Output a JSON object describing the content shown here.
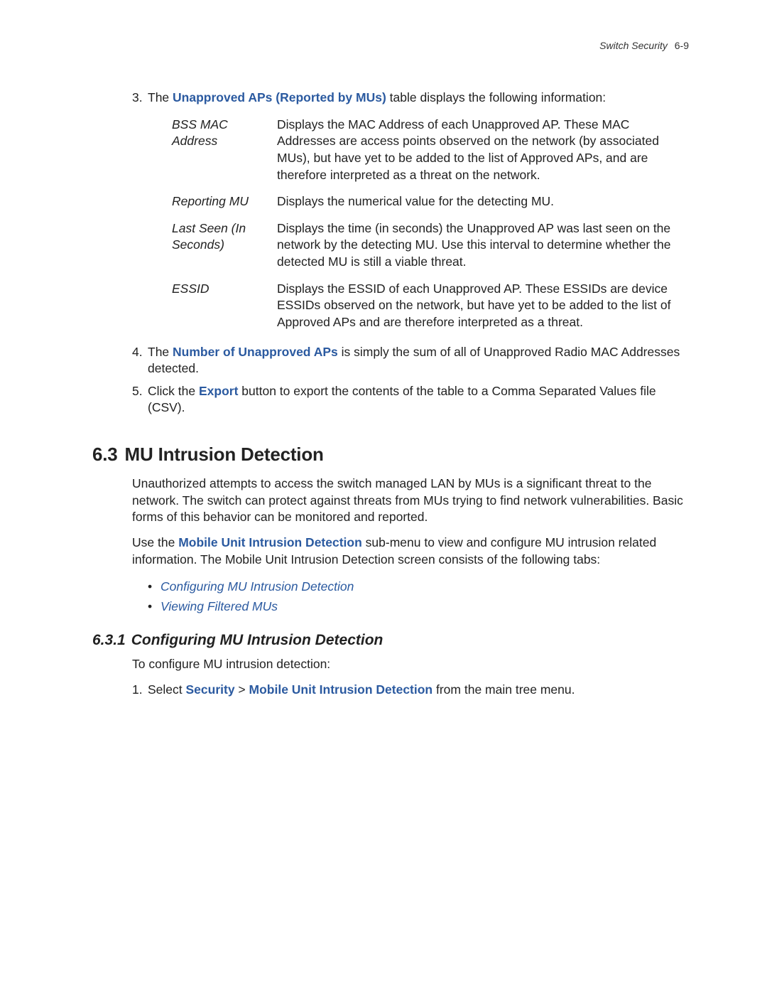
{
  "header": {
    "title": "Switch Security",
    "page": "6-9"
  },
  "list_top": {
    "item3": {
      "num": "3.",
      "pre": "The ",
      "bold": "Unapproved APs (Reported by MUs)",
      "post": " table displays the following information:"
    },
    "defs": [
      {
        "term": "BSS MAC Address",
        "desc": "Displays the MAC Address of each Unapproved AP. These MAC Addresses are access points observed on the network (by associated MUs), but have yet to be added to the list of Approved APs, and are therefore interpreted as a threat on the network."
      },
      {
        "term": "Reporting MU",
        "desc": "Displays the numerical value for the detecting MU."
      },
      {
        "term": "Last Seen (In Seconds)",
        "desc": "Displays the time (in seconds) the Unapproved AP was last seen on the network by the detecting MU. Use this interval to determine whether the detected MU is still a viable threat."
      },
      {
        "term": "ESSID",
        "desc": "Displays the ESSID of each Unapproved AP. These ESSIDs are device ESSIDs observed on the network, but have yet to be added to the list of Approved APs and are therefore interpreted as a threat."
      }
    ],
    "item4": {
      "num": "4.",
      "pre": "The ",
      "bold": "Number of Unapproved APs",
      "post": " is simply the sum of all of Unapproved Radio MAC Addresses detected."
    },
    "item5": {
      "num": "5.",
      "pre": "Click the ",
      "bold": "Export",
      "post": " button to export the contents of the table to a Comma Separated Values file (CSV)."
    }
  },
  "section63": {
    "num": "6.3",
    "title": "MU Intrusion Detection",
    "para1": "Unauthorized attempts to access the switch managed LAN by MUs is a significant threat to the network. The switch can protect against threats from MUs trying to find network vulnerabilities. Basic forms of this behavior can be monitored and reported.",
    "para2_pre": "Use the ",
    "para2_bold": "Mobile Unit Intrusion Detection",
    "para2_post": " sub-menu to view and configure MU intrusion related information. The Mobile Unit Intrusion Detection screen consists of the following tabs:",
    "bullets": [
      "Configuring MU Intrusion Detection",
      "Viewing Filtered MUs"
    ]
  },
  "section631": {
    "num": "6.3.1",
    "title": "Configuring MU Intrusion Detection",
    "intro": "To configure MU intrusion detection:",
    "step1": {
      "num": "1.",
      "pre": "Select ",
      "bold1": "Security",
      "sep": " > ",
      "bold2": "Mobile Unit Intrusion Detection",
      "post": " from the main tree menu."
    }
  }
}
